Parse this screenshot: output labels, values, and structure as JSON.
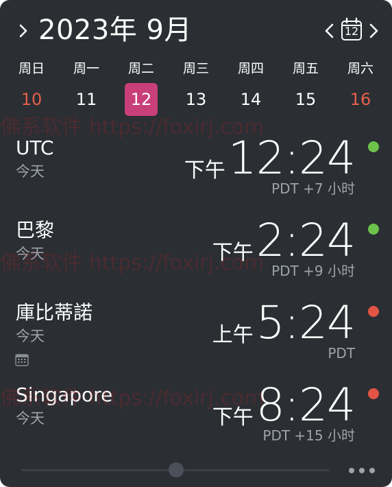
{
  "header": {
    "title": "2023年 9月",
    "today_icon_number": "12",
    "expand_icon": "chevron-right-icon",
    "prev_icon": "chevron-left-icon",
    "next_icon": "chevron-right-icon",
    "today_icon": "calendar-icon"
  },
  "week": {
    "weekdays": [
      "周日",
      "周一",
      "周二",
      "周三",
      "周四",
      "周五",
      "周六"
    ],
    "dates": [
      "10",
      "11",
      "12",
      "13",
      "14",
      "15",
      "16"
    ],
    "selected_index": 2
  },
  "clocks": [
    {
      "city": "UTC",
      "day": "今天",
      "ampm": "下午",
      "time": "12:24",
      "offset": "PDT +7 小时",
      "status_color": "#6cc24a",
      "has_calendar_icon": false
    },
    {
      "city": "巴黎",
      "day": "今天",
      "ampm": "下午",
      "time": "2:24",
      "offset": "PDT +9 小时",
      "status_color": "#6cc24a",
      "has_calendar_icon": false
    },
    {
      "city": "庫比蒂諾",
      "day": "今天",
      "ampm": "上午",
      "time": "5:24",
      "offset": "PDT",
      "status_color": "#e25443",
      "has_calendar_icon": true
    },
    {
      "city": "Singapore",
      "day": "今天",
      "ampm": "下午",
      "time": "8:24",
      "offset": "PDT +15 小时",
      "status_color": "#e25443",
      "has_calendar_icon": false
    }
  ],
  "watermark": "佛系软件 https://foxirj.com",
  "colors": {
    "background": "#2b2e33",
    "accent": "#c93f7a",
    "weekend": "#e4604a",
    "secondary_text": "#9ea3ab"
  }
}
